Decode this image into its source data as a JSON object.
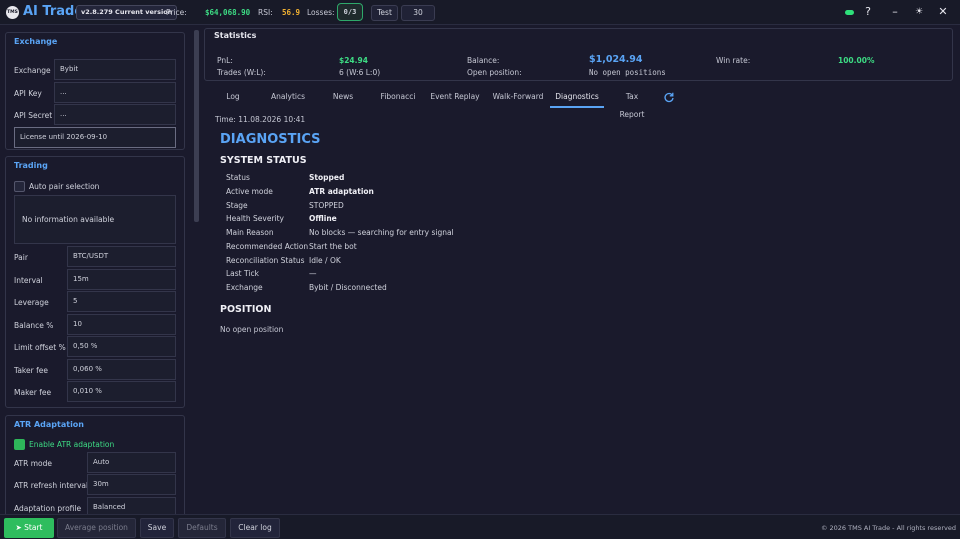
{
  "app": {
    "logo_text": "TMS",
    "title": "AI Trade",
    "version": "v2.8.279 Current version"
  },
  "topbar": {
    "price_label": "Price:",
    "price_value": "$64,068.90",
    "rsi_label": "RSI:",
    "rsi_value": "56.9",
    "losses_label": "Losses:",
    "losses_value": "0/3",
    "test_label": "Test",
    "number_value": "30",
    "help_icon": "?",
    "minimize_icon": "–",
    "theme_icon": "☀",
    "close_icon": "✕",
    "colors": {
      "price": "#3ddc84",
      "rsi": "#f0b132",
      "status_dot": "#2ee07a"
    }
  },
  "sidebar": {
    "exchange": {
      "title": "Exchange",
      "exchange_label": "Exchange",
      "exchange_value": "Bybit",
      "api_key_label": "API Key",
      "api_key_value": "...",
      "api_secret_label": "API Secret",
      "api_secret_value": "...",
      "license_value": "License until 2026-09-10"
    },
    "trading": {
      "title": "Trading",
      "auto_pair_label": "Auto pair selection",
      "info_text": "No information available",
      "fields": [
        {
          "label": "Pair",
          "value": "BTC/USDT"
        },
        {
          "label": "Interval",
          "value": "15m"
        },
        {
          "label": "Leverage",
          "value": "5"
        },
        {
          "label": "Balance %",
          "value": "10"
        },
        {
          "label": "Limit offset %",
          "value": "0,50 %"
        },
        {
          "label": "Taker fee",
          "value": "0,060 %"
        },
        {
          "label": "Maker fee",
          "value": "0,010 %"
        }
      ]
    },
    "atr": {
      "title": "ATR Adaptation",
      "enable_label": "Enable ATR adaptation",
      "fields": [
        {
          "label": "ATR mode",
          "value": "Auto"
        },
        {
          "label": "ATR refresh interval",
          "value": "30m"
        },
        {
          "label": "Adaptation profile",
          "value": "Balanced"
        }
      ]
    }
  },
  "statistics": {
    "title": "Statistics",
    "pnl_label": "PnL:",
    "pnl_value": "$24.94",
    "trades_label": "Trades (W:L):",
    "trades_value": "6 (W:6 L:0)",
    "balance_label": "Balance:",
    "balance_value": "$1,024.94",
    "open_position_label": "Open position:",
    "open_position_value": "No open positions",
    "winrate_label": "Win rate:",
    "winrate_value": "100.00%",
    "colors": {
      "positive": "#3ddc84",
      "balance": "#5aa4f5"
    }
  },
  "tabs": [
    "Log",
    "Analytics",
    "News",
    "Fibonacci",
    "Event Replay",
    "Walk-Forward",
    "Diagnostics",
    "Tax Report"
  ],
  "diagnostics": {
    "time": "Time: 11.08.2026 10:41",
    "heading": "DIAGNOSTICS",
    "system_status_heading": "SYSTEM STATUS",
    "rows": [
      {
        "label": "Status",
        "value": "Stopped"
      },
      {
        "label": "Active mode",
        "value": "ATR adaptation"
      },
      {
        "label": "Stage",
        "value": "STOPPED"
      },
      {
        "label": "Health Severity",
        "value": "Offline"
      },
      {
        "label": "Main Reason",
        "value": "No blocks — searching for entry signal"
      },
      {
        "label": "Recommended Action",
        "value": "Start the bot"
      },
      {
        "label": "Reconciliation Status",
        "value": "Idle / OK"
      },
      {
        "label": "Last Tick",
        "value": "—"
      },
      {
        "label": "Exchange",
        "value": "Bybit / Disconnected"
      }
    ],
    "position_heading": "POSITION",
    "position_text": "No open position"
  },
  "bottombar": {
    "start_label": "➤ Start",
    "average_label": "Average position",
    "save_label": "Save",
    "defaults_label": "Defaults",
    "clear_log_label": "Clear log",
    "footer": "© 2026 TMS AI Trade - All rights reserved"
  }
}
